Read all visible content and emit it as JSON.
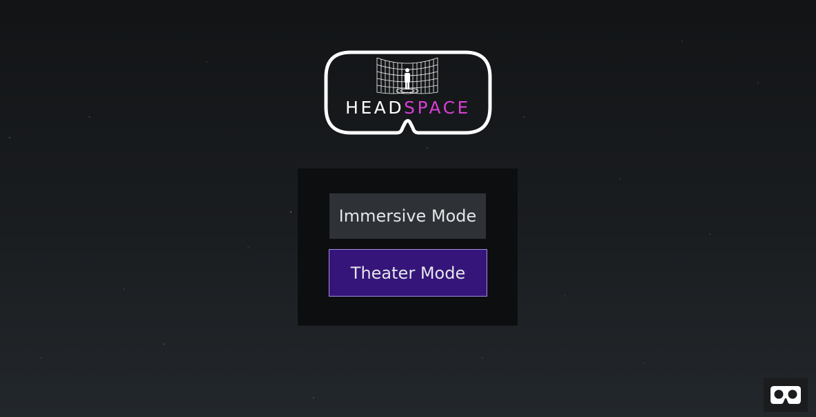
{
  "logo": {
    "word_head": "HEAD",
    "word_space": "SPACE",
    "accent_color": "#d63fd3",
    "icon": "vr-headset-outline-icon",
    "emblem": "person-in-grid-room-icon"
  },
  "menu": {
    "immersive_label": "Immersive Mode",
    "theater_label": "Theater Mode",
    "theater_color": "#35157a",
    "immersive_color": "#2e3236"
  },
  "vr_toggle": {
    "icon": "vr-cardboard-icon"
  }
}
